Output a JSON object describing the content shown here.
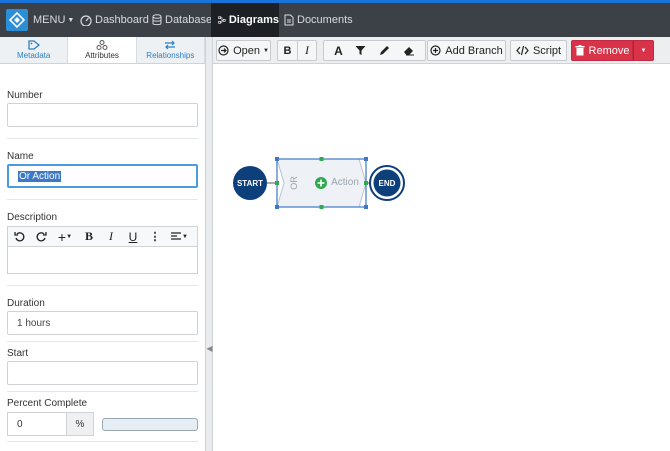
{
  "nav": {
    "menu_label": "MENU",
    "items": [
      {
        "label": "Dashboard",
        "icon": "dashboard-icon"
      },
      {
        "label": "Database",
        "icon": "database-icon"
      },
      {
        "label": "Diagrams",
        "icon": "diagram-icon",
        "active": true
      },
      {
        "label": "Documents",
        "icon": "document-icon"
      }
    ]
  },
  "tabs": [
    {
      "label": "Metadata",
      "icon": "tag-icon"
    },
    {
      "label": "Attributes",
      "icon": "attributes-icon",
      "active": true
    },
    {
      "label": "Relationships",
      "icon": "swap-icon"
    }
  ],
  "form": {
    "number_label": "Number",
    "number_value": "",
    "name_label": "Name",
    "name_value": "Or Action",
    "description_label": "Description",
    "duration_label": "Duration",
    "duration_value": "1 hours",
    "start_label": "Start",
    "start_value": "",
    "percent_label": "Percent Complete",
    "percent_value": "0",
    "percent_unit": "%",
    "percent_progress": 0
  },
  "rte_toolbar": [
    "undo-icon",
    "redo-icon",
    "insert-icon",
    "bold-icon",
    "italic-icon",
    "underline-icon",
    "more-icon",
    "align-icon"
  ],
  "rte_glyphs": {
    "insert": "+",
    "bold": "B",
    "italic": "I",
    "underline": "U",
    "more": "⋮"
  },
  "toolbar": {
    "open_label": "Open",
    "bold_label": "B",
    "italic_label": "I",
    "text_label": "A",
    "add_branch_label": "Add Branch",
    "script_label": "Script",
    "remove_label": "Remove"
  },
  "diagram": {
    "start_label": "START",
    "end_label": "END",
    "action_label": "Action",
    "gate_label": "OR"
  },
  "colors": {
    "accent": "#1a73d9",
    "nav_bg": "#3c4148",
    "node_blue": "#0d3f7a",
    "remove_red": "#d9334a",
    "add_green": "#2fa84f"
  }
}
